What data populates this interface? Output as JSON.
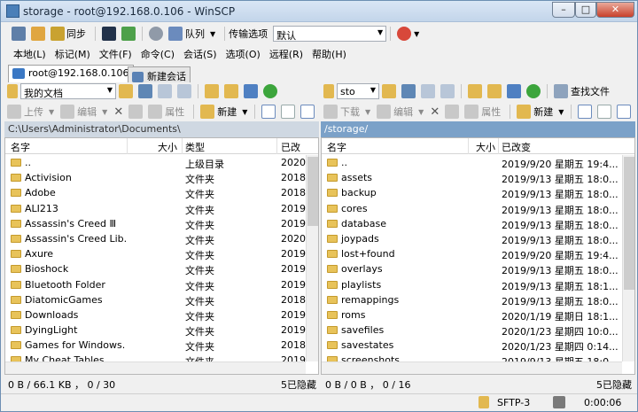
{
  "window": {
    "title": "storage - root@192.168.0.106 - WinSCP",
    "min": "–",
    "max": "□",
    "close": "✕"
  },
  "toolbar": {
    "sync": "同步",
    "queue": "队列",
    "transfer_options": "传输选项",
    "transfer_default": "默认"
  },
  "menu": [
    "本地(L)",
    "标记(M)",
    "文件(F)",
    "命令(C)",
    "会话(S)",
    "选项(O)",
    "远程(R)",
    "帮助(H)"
  ],
  "tabs": {
    "session": "root@192.168.0.106",
    "new_session": "新建会话"
  },
  "left": {
    "location": "我的文档",
    "actions": {
      "upload": "上传",
      "edit": "编辑",
      "properties": "属性",
      "new": "新建"
    },
    "path": "C:\\Users\\Administrator\\Documents\\",
    "columns": {
      "name": "名字",
      "size": "大小",
      "type": "类型",
      "changed": "已改"
    },
    "files": [
      {
        "name": "..",
        "type": "上级目录",
        "changed": "2020"
      },
      {
        "name": "Activision",
        "type": "文件夹",
        "changed": "2018"
      },
      {
        "name": "Adobe",
        "type": "文件夹",
        "changed": "2018"
      },
      {
        "name": "ALI213",
        "type": "文件夹",
        "changed": "2019"
      },
      {
        "name": "Assassin's Creed Ⅲ",
        "type": "文件夹",
        "changed": "2019"
      },
      {
        "name": "Assassin's Creed Lib...",
        "type": "文件夹",
        "changed": "2020"
      },
      {
        "name": "Axure",
        "type": "文件夹",
        "changed": "2019"
      },
      {
        "name": "Bioshock",
        "type": "文件夹",
        "changed": "2019"
      },
      {
        "name": "Bluetooth Folder",
        "type": "文件夹",
        "changed": "2019"
      },
      {
        "name": "DiatomicGames",
        "type": "文件夹",
        "changed": "2018"
      },
      {
        "name": "Downloads",
        "type": "文件夹",
        "changed": "2019"
      },
      {
        "name": "DyingLight",
        "type": "文件夹",
        "changed": "2019"
      },
      {
        "name": "Games for Windows...",
        "type": "文件夹",
        "changed": "2018"
      },
      {
        "name": "My Cheat Tables",
        "type": "文件夹",
        "changed": "2019"
      }
    ],
    "status": "0 B / 66.1 KB ， 0 / 30",
    "hidden": "5已隐藏"
  },
  "right": {
    "location": "sto",
    "find": "查找文件",
    "actions": {
      "download": "下载",
      "edit": "编辑",
      "properties": "属性",
      "new": "新建"
    },
    "path": "/storage/",
    "columns": {
      "name": "名字",
      "size": "大小",
      "changed": "已改变"
    },
    "files": [
      {
        "name": "..",
        "changed": "2019/9/20 星期五 19:4..."
      },
      {
        "name": "assets",
        "changed": "2019/9/13 星期五 18:0..."
      },
      {
        "name": "backup",
        "changed": "2019/9/13 星期五 18:0..."
      },
      {
        "name": "cores",
        "changed": "2019/9/13 星期五 18:0..."
      },
      {
        "name": "database",
        "changed": "2019/9/13 星期五 18:0..."
      },
      {
        "name": "joypads",
        "changed": "2019/9/13 星期五 18:0..."
      },
      {
        "name": "lost+found",
        "changed": "2019/9/20 星期五 19:4..."
      },
      {
        "name": "overlays",
        "changed": "2019/9/13 星期五 18:0..."
      },
      {
        "name": "playlists",
        "changed": "2019/9/13 星期五 18:1..."
      },
      {
        "name": "remappings",
        "changed": "2019/9/13 星期五 18:0..."
      },
      {
        "name": "roms",
        "changed": "2020/1/19 星期日 18:1..."
      },
      {
        "name": "savefiles",
        "changed": "2020/1/23 星期四 10:0..."
      },
      {
        "name": "savestates",
        "changed": "2020/1/23 星期四 0:14..."
      },
      {
        "name": "screenshots",
        "changed": "2019/9/13 星期五 18:0..."
      }
    ],
    "status": "0 B / 0 B ， 0 / 16",
    "hidden": "5已隐藏"
  },
  "statusbar": {
    "protocol": "SFTP-3",
    "time": "0:00:06"
  }
}
